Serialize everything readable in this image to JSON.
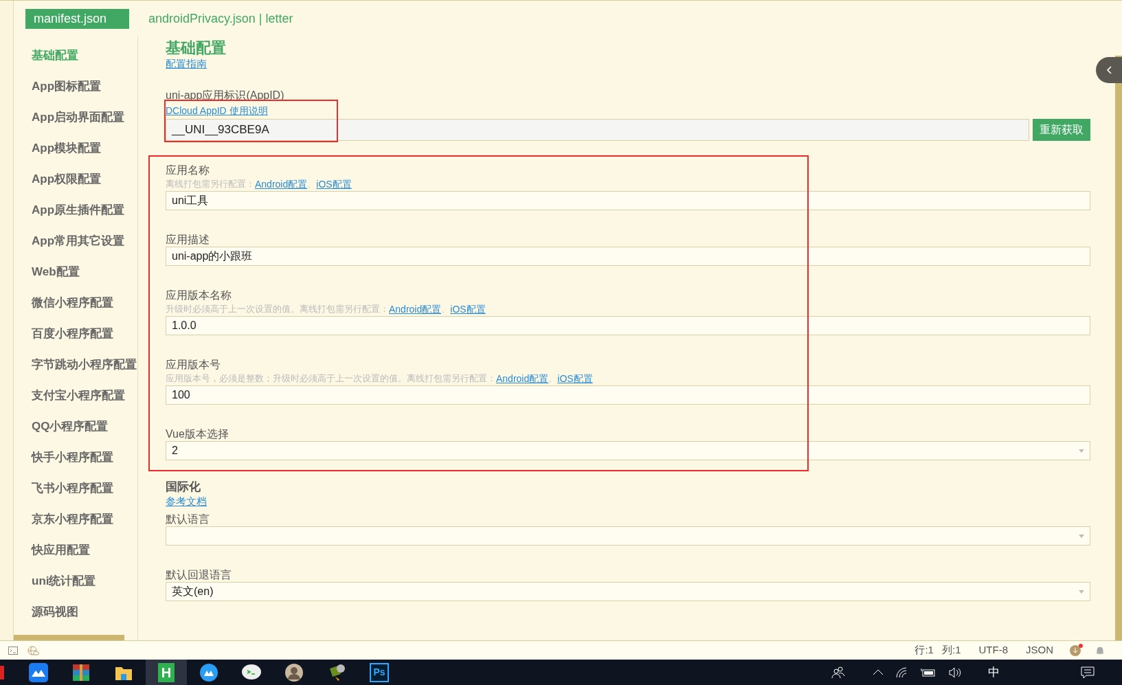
{
  "tabs": [
    {
      "label": "manifest.json",
      "selected": true
    },
    {
      "label": "androidPrivacy.json | letter",
      "selected": false
    }
  ],
  "sidebar": {
    "items": [
      {
        "label": "基础配置",
        "selected": true
      },
      {
        "label": "App图标配置",
        "selected": false
      },
      {
        "label": "App启动界面配置",
        "selected": false
      },
      {
        "label": "App模块配置",
        "selected": false
      },
      {
        "label": "App权限配置",
        "selected": false
      },
      {
        "label": "App原生插件配置",
        "selected": false
      },
      {
        "label": "App常用其它设置",
        "selected": false
      },
      {
        "label": "Web配置",
        "selected": false
      },
      {
        "label": "微信小程序配置",
        "selected": false
      },
      {
        "label": "百度小程序配置",
        "selected": false
      },
      {
        "label": "字节跳动小程序配置",
        "selected": false
      },
      {
        "label": "支付宝小程序配置",
        "selected": false
      },
      {
        "label": "QQ小程序配置",
        "selected": false
      },
      {
        "label": "快手小程序配置",
        "selected": false
      },
      {
        "label": "飞书小程序配置",
        "selected": false
      },
      {
        "label": "京东小程序配置",
        "selected": false
      },
      {
        "label": "快应用配置",
        "selected": false
      },
      {
        "label": "uni统计配置",
        "selected": false
      },
      {
        "label": "源码视图",
        "selected": false
      }
    ]
  },
  "sections": [
    {
      "title": "基础配置",
      "kind": "big",
      "link": "配置指南",
      "first_field_boxed": true,
      "other_fields_boxed": true,
      "fields": [
        {
          "kind": "appid",
          "label": "uni-app应用标识(AppID)",
          "link": "DCloud AppID 使用说明",
          "value": "__UNI__93CBE9A",
          "button": "重新获取"
        },
        {
          "kind": "text",
          "label": "应用名称",
          "hint": "离线打包需另行配置：",
          "separator": "、",
          "links": [
            "Android配置",
            "iOS配置"
          ],
          "value": "uni工具"
        },
        {
          "kind": "text",
          "label": "应用描述",
          "value": "uni-app的小跟班"
        },
        {
          "kind": "text",
          "label": "应用版本名称",
          "hint": "升级时必须高于上一次设置的值。离线打包需另行配置：",
          "separator": "、",
          "links": [
            "Android配置",
            "iOS配置"
          ],
          "value": "1.0.0"
        },
        {
          "kind": "text",
          "label": "应用版本号",
          "hint": "应用版本号，必须是整数；升级时必须高于上一次设置的值。离线打包需另行配置：",
          "separator": "、",
          "links": [
            "Android配置",
            "iOS配置"
          ],
          "value": "100"
        },
        {
          "kind": "select",
          "label": "Vue版本选择",
          "value": "2"
        }
      ]
    },
    {
      "title": "国际化",
      "kind": "small",
      "link": "参考文档",
      "fields": [
        {
          "kind": "select",
          "label": "默认语言"
        },
        {
          "kind": "select",
          "label": "默认回退语言",
          "value": "英文(en)"
        }
      ]
    }
  ],
  "status_bar": {
    "items": [
      "行:1",
      "列:1",
      "UTF-8",
      "JSON"
    ],
    "has_update": true
  },
  "taskbar": {
    "apps": [
      {
        "kind": "meeting",
        "selected": false
      },
      {
        "kind": "archive",
        "selected": false
      },
      {
        "kind": "folder",
        "selected": false
      },
      {
        "kind": "hbuilder",
        "label": "H",
        "selected": true
      },
      {
        "kind": "cloud",
        "selected": false
      },
      {
        "kind": "chat",
        "selected": false
      },
      {
        "kind": "photo",
        "selected": false
      },
      {
        "kind": "tool",
        "selected": false
      },
      {
        "kind": "photoshop",
        "label": "Ps",
        "selected": false
      }
    ],
    "tray": {
      "ime": "中"
    }
  }
}
